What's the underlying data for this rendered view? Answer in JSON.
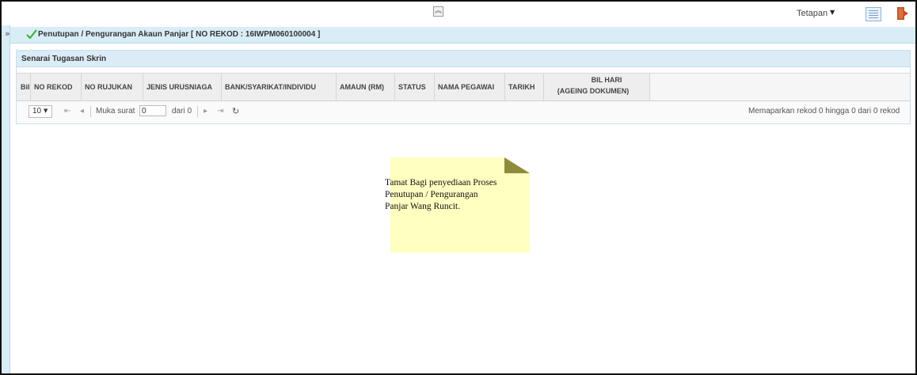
{
  "topbar": {
    "collapse_glyph": "︽",
    "settings_label": "Tetapan",
    "settings_caret": "▼",
    "list_icon": "list-view-icon",
    "logout_icon": "logout-icon"
  },
  "sidebar": {
    "expand_glyph": "»"
  },
  "page": {
    "title": "Penutupan / Pengurangan Akaun Panjar [ NO REKOD : 16IWPM060100004 ]",
    "title_icon": "checkmark-icon",
    "accent": "#3aaa35"
  },
  "panel": {
    "heading": "Senarai Tugasan Skrin",
    "columns": [
      {
        "line1": "Bil",
        "line2": ""
      },
      {
        "line1": "NO REKOD",
        "line2": ""
      },
      {
        "line1": "NO RUJUKAN",
        "line2": ""
      },
      {
        "line1": "JENIS URUSNIAGA",
        "line2": ""
      },
      {
        "line1": "BANK/SYARIKAT/INDIVIDU",
        "line2": ""
      },
      {
        "line1": "AMAUN (RM)",
        "line2": ""
      },
      {
        "line1": "STATUS",
        "line2": ""
      },
      {
        "line1": "NAMA PEGAWAI",
        "line2": ""
      },
      {
        "line1": "TARIKH",
        "line2": ""
      },
      {
        "line1": "BIL HARI",
        "line2": "(AGEING DOKUMEN)"
      }
    ],
    "pager": {
      "page_size": "10",
      "page_label": "Muka surat",
      "page_value": "0",
      "of_label": "dari 0",
      "record_info": "Memaparkan rekod 0 hingga 0 dari 0 rekod"
    }
  },
  "note": {
    "text_lines": [
      "Tamat Bagi penyediaan Proses",
      "Penutupan / Pengurangan",
      "Panjar Wang Runcit."
    ],
    "bg_color": "#ffffc0",
    "fold_color": "#8f8b3a"
  }
}
